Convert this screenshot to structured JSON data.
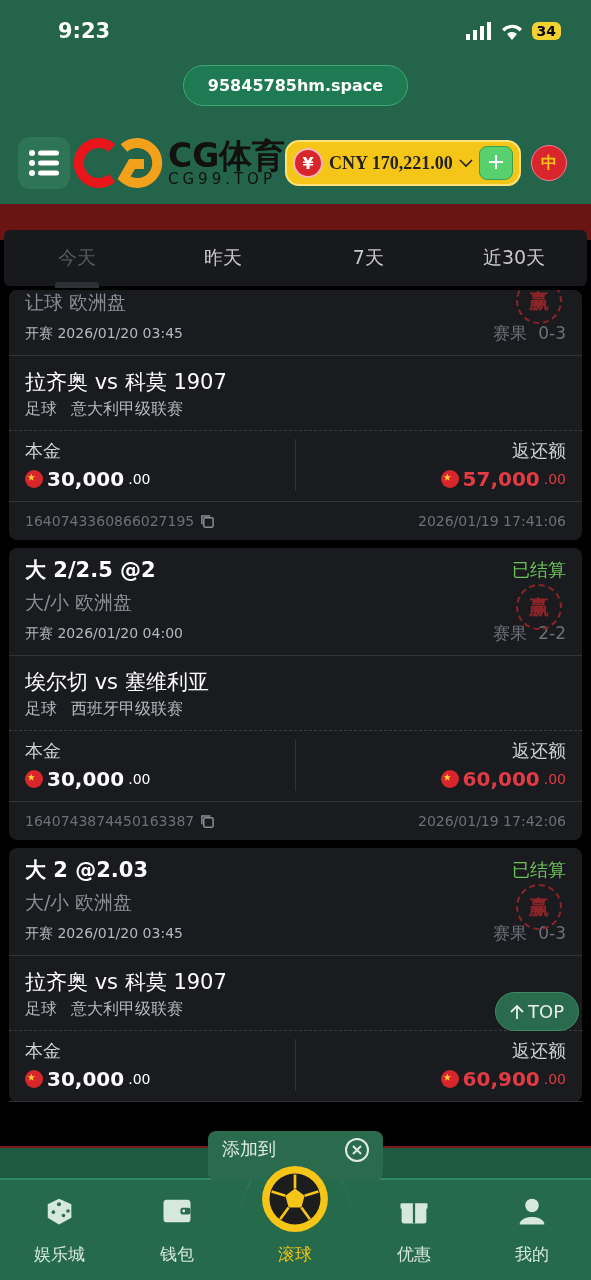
{
  "status_bar": {
    "time": "9:23",
    "battery": "34"
  },
  "url_pill": "95845785hm.space",
  "header": {
    "logo_text": "CG体育",
    "logo_sub": "CG99.TOP",
    "currency_symbol": "¥",
    "balance": "CNY 170,221.00",
    "language": "中"
  },
  "tabs": [
    {
      "label": "今天",
      "selected": true
    },
    {
      "label": "昨天",
      "selected": false
    },
    {
      "label": "7天",
      "selected": false
    },
    {
      "label": "近30天",
      "selected": false
    }
  ],
  "bets": [
    {
      "market": "让球 欧洲盘",
      "kickoff_label": "开赛",
      "kickoff": "2026/01/20 03:45",
      "result": "赛果  0-3",
      "stamp": "赢",
      "match": "拉齐奥 vs 科莫 1907",
      "sport": "足球",
      "league": "意大利甲级联赛",
      "stake_label": "本金",
      "stake": "30,000",
      "stake_dec": ".00",
      "return_label": "返还额",
      "return": "57,000",
      "return_dec": ".00",
      "order_id": "1640743360866027195",
      "placed": "2026/01/19 17:41:06"
    },
    {
      "title": "大 2/2.5 @2",
      "status": "已结算",
      "market": "大/小 欧洲盘",
      "kickoff_label": "开赛",
      "kickoff": "2026/01/20 04:00",
      "result": "赛果  2-2",
      "stamp": "赢",
      "match": "埃尔切 vs 塞维利亚",
      "sport": "足球",
      "league": "西班牙甲级联赛",
      "stake_label": "本金",
      "stake": "30,000",
      "stake_dec": ".00",
      "return_label": "返还额",
      "return": "60,000",
      "return_dec": ".00",
      "order_id": "1640743874450163387",
      "placed": "2026/01/19 17:42:06"
    },
    {
      "title": "大 2 @2.03",
      "status": "已结算",
      "market": "大/小 欧洲盘",
      "kickoff_label": "开赛",
      "kickoff": "2026/01/20 03:45",
      "result": "赛果  0-3",
      "stamp": "赢",
      "match": "拉齐奥 vs 科莫 1907",
      "sport": "足球",
      "league": "意大利甲级联赛",
      "stake_label": "本金",
      "stake": "30,000",
      "stake_dec": ".00",
      "return_label": "返还额",
      "return": "60,900",
      "return_dec": ".00"
    }
  ],
  "top_button": "TOP",
  "toast": {
    "text": "添加到"
  },
  "nav": [
    {
      "label": "娱乐城",
      "kind": "dice",
      "selected": false
    },
    {
      "label": "钱包",
      "kind": "wallet",
      "selected": false
    },
    {
      "label": "滚球",
      "kind": "ball",
      "selected": true
    },
    {
      "label": "优惠",
      "kind": "gift",
      "selected": false
    },
    {
      "label": "我的",
      "kind": "user",
      "selected": false
    }
  ]
}
